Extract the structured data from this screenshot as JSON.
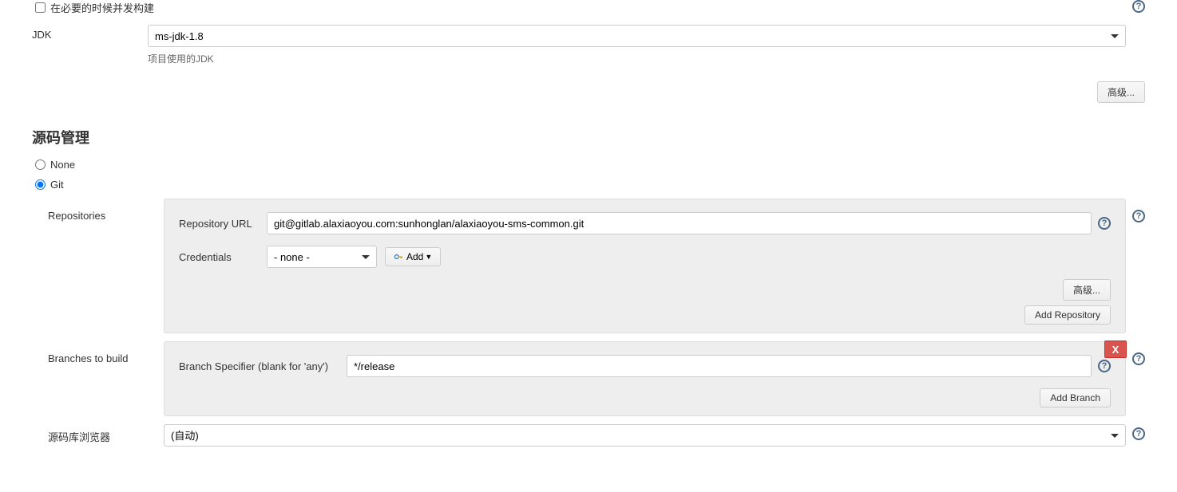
{
  "concurrent": {
    "label": "在必要的时候并发构建"
  },
  "jdk": {
    "label": "JDK",
    "value": "ms-jdk-1.8",
    "help_text": "项目使用的JDK",
    "advanced_btn": "高级..."
  },
  "scm": {
    "title": "源码管理",
    "none_label": "None",
    "git_label": "Git",
    "repositories": {
      "label": "Repositories",
      "repo_url_label": "Repository URL",
      "repo_url_value": "git@gitlab.alaxiaoyou.com:sunhonglan/alaxiaoyou-sms-common.git",
      "credentials_label": "Credentials",
      "credentials_value": "- none -",
      "add_cred_btn": "Add",
      "advanced_btn": "高级...",
      "add_repo_btn": "Add Repository"
    },
    "branches": {
      "label": "Branches to build",
      "specifier_label": "Branch Specifier (blank for 'any')",
      "specifier_value": "*/release",
      "add_branch_btn": "Add Branch",
      "delete_btn": "X"
    },
    "browser": {
      "label": "源码库浏览器",
      "value": "(自动)"
    }
  },
  "help_glyph": "?"
}
